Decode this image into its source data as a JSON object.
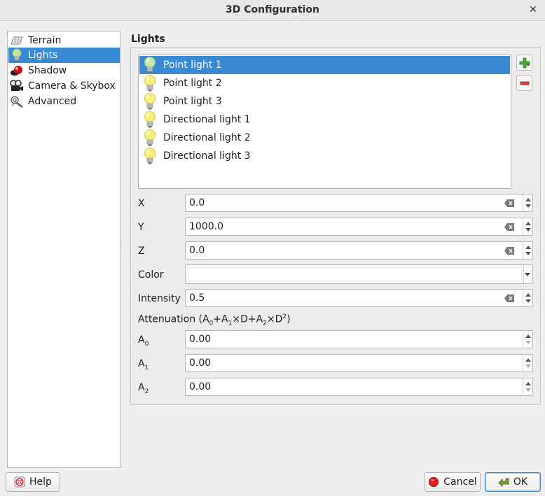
{
  "window": {
    "title": "3D Configuration"
  },
  "nav": {
    "items": [
      {
        "label": "Terrain",
        "icon": "terrain-icon"
      },
      {
        "label": "Lights",
        "icon": "light-bulb-icon"
      },
      {
        "label": "Shadow",
        "icon": "shadow-icon"
      },
      {
        "label": "Camera & Skybox",
        "icon": "camera-icon"
      },
      {
        "label": "Advanced",
        "icon": "advanced-icon"
      }
    ],
    "selected": "Lights"
  },
  "lights": {
    "title": "Lights",
    "items": [
      {
        "label": "Point light 1"
      },
      {
        "label": "Point light 2"
      },
      {
        "label": "Point light 3"
      },
      {
        "label": "Directional light 1"
      },
      {
        "label": "Directional light 2"
      },
      {
        "label": "Directional light 3"
      }
    ],
    "selected": "Point light 1"
  },
  "form": {
    "x_label": "X",
    "x_value": "0.0",
    "y_label": "Y",
    "y_value": "1000.0",
    "z_label": "Z",
    "z_value": "0.0",
    "color_label": "Color",
    "color_value": "#ffffff",
    "intensity_label": "Intensity",
    "intensity_value": "0.5",
    "attenuation": {
      "label": "Attenuation (A",
      "parts": [
        "0",
        "+A",
        "1",
        "×D+A",
        "2",
        "×D",
        "2",
        ")"
      ]
    },
    "a0_label": "A",
    "a0_sub": "0",
    "a0_value": "0.00",
    "a1_label": "A",
    "a1_sub": "1",
    "a1_value": "0.00",
    "a2_label": "A",
    "a2_sub": "2",
    "a2_value": "0.00"
  },
  "buttons": {
    "help": "Help",
    "cancel": "Cancel",
    "ok": "OK"
  },
  "colors": {
    "accent": "#3a8ad3",
    "add": "#3c9a3c",
    "remove": "#c83232",
    "cancel_icon": "#d61f1f"
  }
}
